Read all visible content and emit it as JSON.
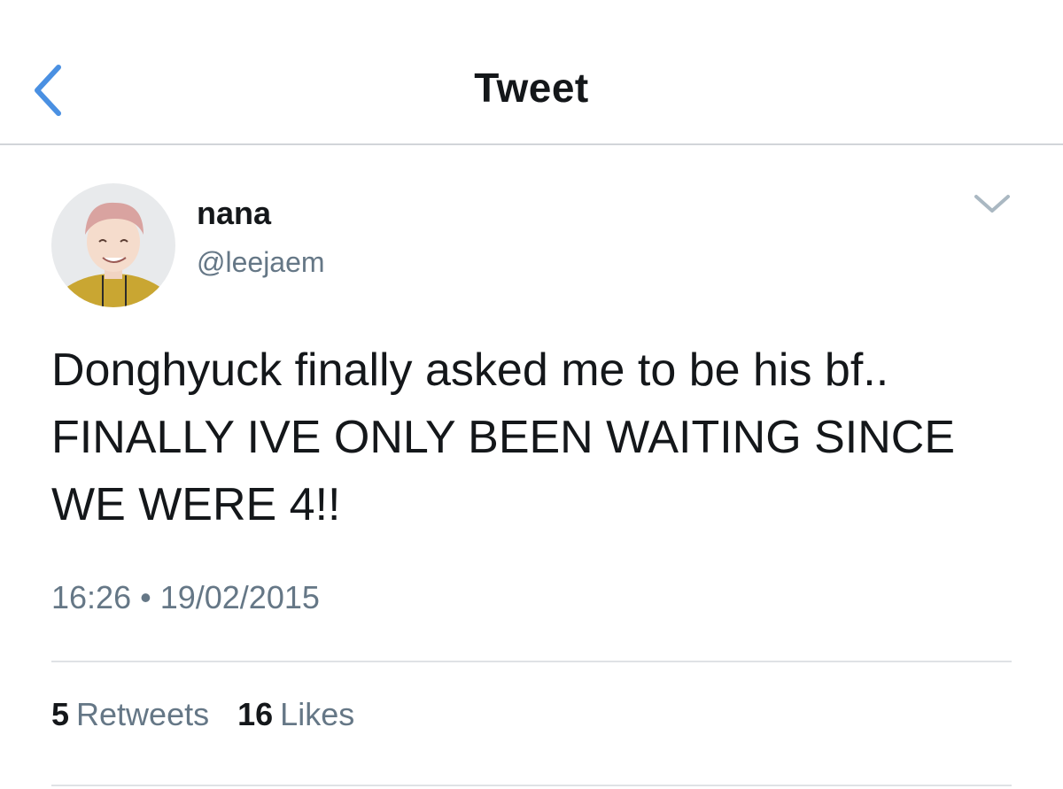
{
  "nav": {
    "title": "Tweet",
    "back_icon": "chevron-left-icon",
    "accent_color": "#4a90e2"
  },
  "tweet": {
    "author": {
      "display_name": "nana",
      "handle": "@leejaem",
      "avatar": "avatar-photo"
    },
    "menu_icon": "chevron-down-icon",
    "text": "Donghyuck finally asked me to be his bf.. FINALLY IVE ONLY BEEN WAITING SINCE WE WERE 4!!",
    "time": "16:26",
    "separator": "•",
    "date": "19/02/2015",
    "stats": {
      "retweets_count": "5",
      "retweets_label": "Retweets",
      "likes_count": "16",
      "likes_label": "Likes"
    }
  }
}
